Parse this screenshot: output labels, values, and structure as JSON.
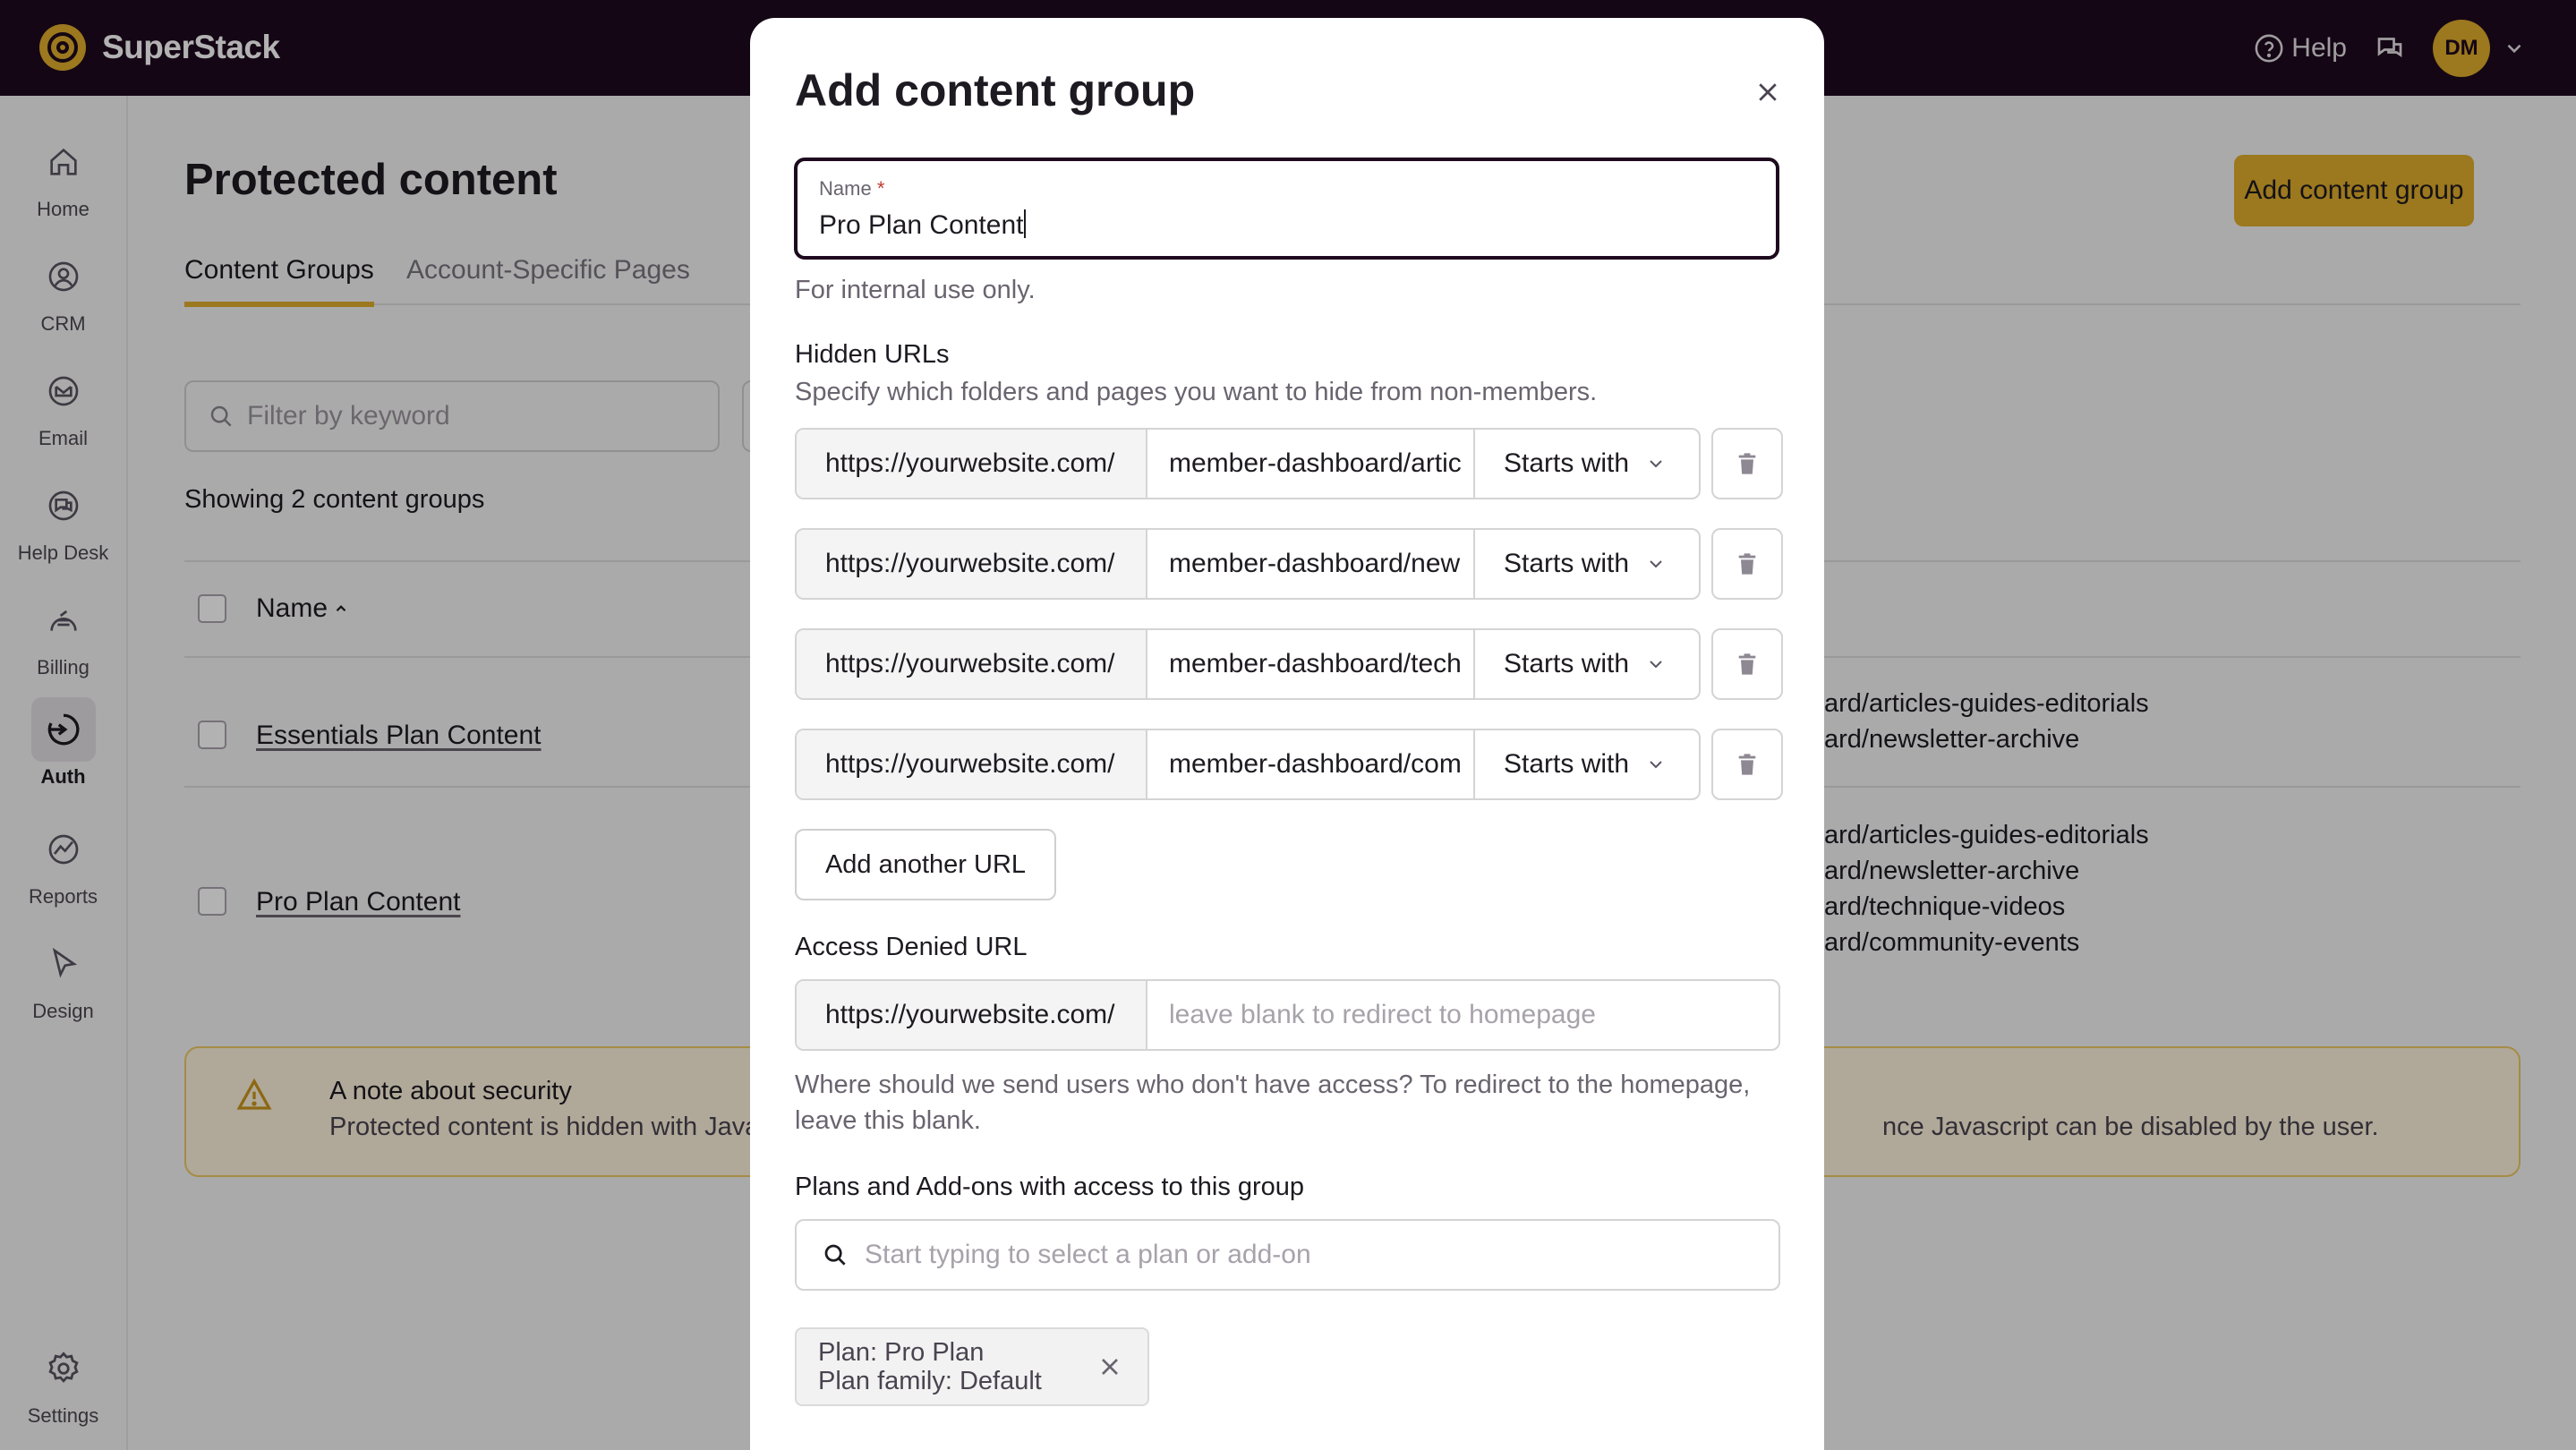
{
  "app": {
    "name": "SuperStack",
    "help_label": "Help",
    "avatar_initials": "DM",
    "brand_color": "#e0ac2c",
    "topbar_color": "#1e0a1e"
  },
  "sidebar": {
    "items": [
      {
        "label": "Home",
        "icon": "home-icon"
      },
      {
        "label": "CRM",
        "icon": "contact-icon"
      },
      {
        "label": "Email",
        "icon": "email-icon"
      },
      {
        "label": "Help Desk",
        "icon": "chat-icon"
      },
      {
        "label": "Billing",
        "icon": "billing-icon"
      },
      {
        "label": "Auth",
        "icon": "auth-icon",
        "active": true
      },
      {
        "label": "Reports",
        "icon": "reports-icon"
      },
      {
        "label": "Design",
        "icon": "cursor-icon"
      }
    ],
    "settings_label": "Settings"
  },
  "page": {
    "title": "Protected content",
    "add_button": "Add content group",
    "tabs": [
      "Content Groups",
      "Account-Specific Pages"
    ],
    "filter_placeholder": "Filter by keyword",
    "count_text": "Showing 2 content groups",
    "column_name": "Name",
    "rows": [
      {
        "name": "Essentials Plan Content",
        "urls": [
          "ard/articles-guides-editorials",
          "ard/newsletter-archive"
        ]
      },
      {
        "name": "Pro Plan Content",
        "urls": [
          "ard/articles-guides-editorials",
          "ard/newsletter-archive",
          "ard/technique-videos",
          "ard/community-events"
        ]
      }
    ],
    "alert": {
      "title": "A note about security",
      "text_left": "Protected content is hidden with Javascr",
      "text_right": "nce Javascript can be disabled by the user."
    }
  },
  "modal": {
    "title": "Add content group",
    "name_label": "Name",
    "name_required_mark": "*",
    "name_value": "Pro Plan Content",
    "name_hint": "For internal use only.",
    "hidden_urls_label": "Hidden URLs",
    "hidden_urls_hint": "Specify which folders and pages you want to hide from non-members.",
    "url_rows": [
      {
        "prefix": "https://yourwebsite.com/",
        "path": "member-dashboard/articles-guides-editorials",
        "match": "Starts with"
      },
      {
        "prefix": "https://yourwebsite.com/",
        "path": "member-dashboard/newsletter-archive",
        "match": "Starts with"
      },
      {
        "prefix": "https://yourwebsite.com/",
        "path": "member-dashboard/technique-videos",
        "match": "Starts with"
      },
      {
        "prefix": "https://yourwebsite.com/",
        "path": "member-dashboard/community-events",
        "match": "Starts with"
      }
    ],
    "add_url_button": "Add another URL",
    "denied_label": "Access Denied URL",
    "denied_prefix": "https://yourwebsite.com/",
    "denied_placeholder": "leave blank to redirect to homepage",
    "denied_hint_1": "Where should we send users who don't have access? To redirect to the homepage,",
    "denied_hint_2": "leave this blank.",
    "plans_label": "Plans and Add-ons with access to this group",
    "plans_placeholder": "Start typing to select a plan or add-on",
    "chips": [
      {
        "line1": "Plan: Pro Plan",
        "line2": "Plan family: Default"
      }
    ]
  }
}
